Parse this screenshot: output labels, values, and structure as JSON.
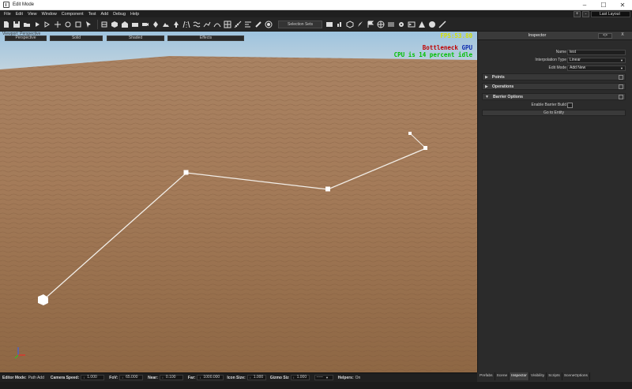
{
  "window": {
    "title": "Edit Mode",
    "min": "–",
    "max": "☐",
    "close": "✕"
  },
  "menu": [
    "File",
    "Edit",
    "View",
    "Window",
    "Component",
    "Test",
    "Add",
    "Debug",
    "Help"
  ],
  "menu_right": {
    "plus": "+",
    "minus": "-",
    "layout": "Last Layout"
  },
  "toolbar": {
    "selection_sets": "Selection Sets",
    "icons": [
      "new-file-icon",
      "save-icon",
      "open-folder-icon",
      "play-icon",
      "step-icon",
      "move-icon",
      "rotate-icon",
      "scale-icon",
      "select-icon",
      "snap-icon",
      "entity-icon",
      "component-icon",
      "layer-icon",
      "camera-icon",
      "light-icon",
      "terrain-icon",
      "vegetation-icon",
      "road-icon",
      "river-icon",
      "path-icon",
      "spline-icon",
      "grid-icon",
      "measure-icon",
      "align-icon",
      "bone-icon",
      "physics-icon",
      "lock-icon",
      "link-icon",
      "unlink-icon",
      "ruler-icon",
      "visibility-icon",
      "hide-icon"
    ],
    "right_icons": [
      "render-icon",
      "profile-icon",
      "cube-icon",
      "paint-icon",
      "flag-icon",
      "globe-icon",
      "stack-icon",
      "cog-icon",
      "console-icon",
      "warning-triangle-icon",
      "palette-icon",
      "brush-icon"
    ]
  },
  "viewport": {
    "label": "Viewport: Perspective",
    "tabs": [
      "Perspective",
      "Solid",
      "Shaded",
      "Effects"
    ],
    "fps": "FPS:53.80",
    "bottleneck_prefix": "Bottleneck",
    "bottleneck_gpu": "GPU",
    "cpu": "CPU is 14 percent idle"
  },
  "inspector": {
    "title": "Inspector",
    "pin": "<>",
    "close": "X",
    "name_label": "Name",
    "name_value": "test",
    "interp_label": "Interpolation Type",
    "interp_value": "Linear",
    "edit_mode_label": "Edit Mode",
    "edit_mode_value": "Add New",
    "sections": [
      "Points",
      "Operations",
      "Barrier Options"
    ],
    "enable_barrier_label": "Enable Barrier Build",
    "goto_entity": "Go to Entity",
    "tabs": [
      "Prefabs",
      "Scene",
      "Inspector",
      "Visibility",
      "Scripts",
      "SceneOptions"
    ],
    "active_tab": "Inspector"
  },
  "statusbar": {
    "editor_mode_label": "Editor Mode:",
    "editor_mode_value": "Path Add",
    "camera_speed_label": "Camera Speed:",
    "camera_speed_value": "1.000",
    "fov_label": "FoV:",
    "fov_value": "65.000",
    "near_label": "Near:",
    "near_value": "0.100",
    "far_label": "Far:",
    "far_value": "1000.000",
    "icon_size_label": "Icon Size:",
    "icon_size_value": "1.000",
    "gizmo_size_label": "Gizmo Siz",
    "gizmo_size_value": "1.000",
    "dropdown_value": "-----",
    "helpers_label": "Helpers:",
    "helpers_value": "On"
  }
}
